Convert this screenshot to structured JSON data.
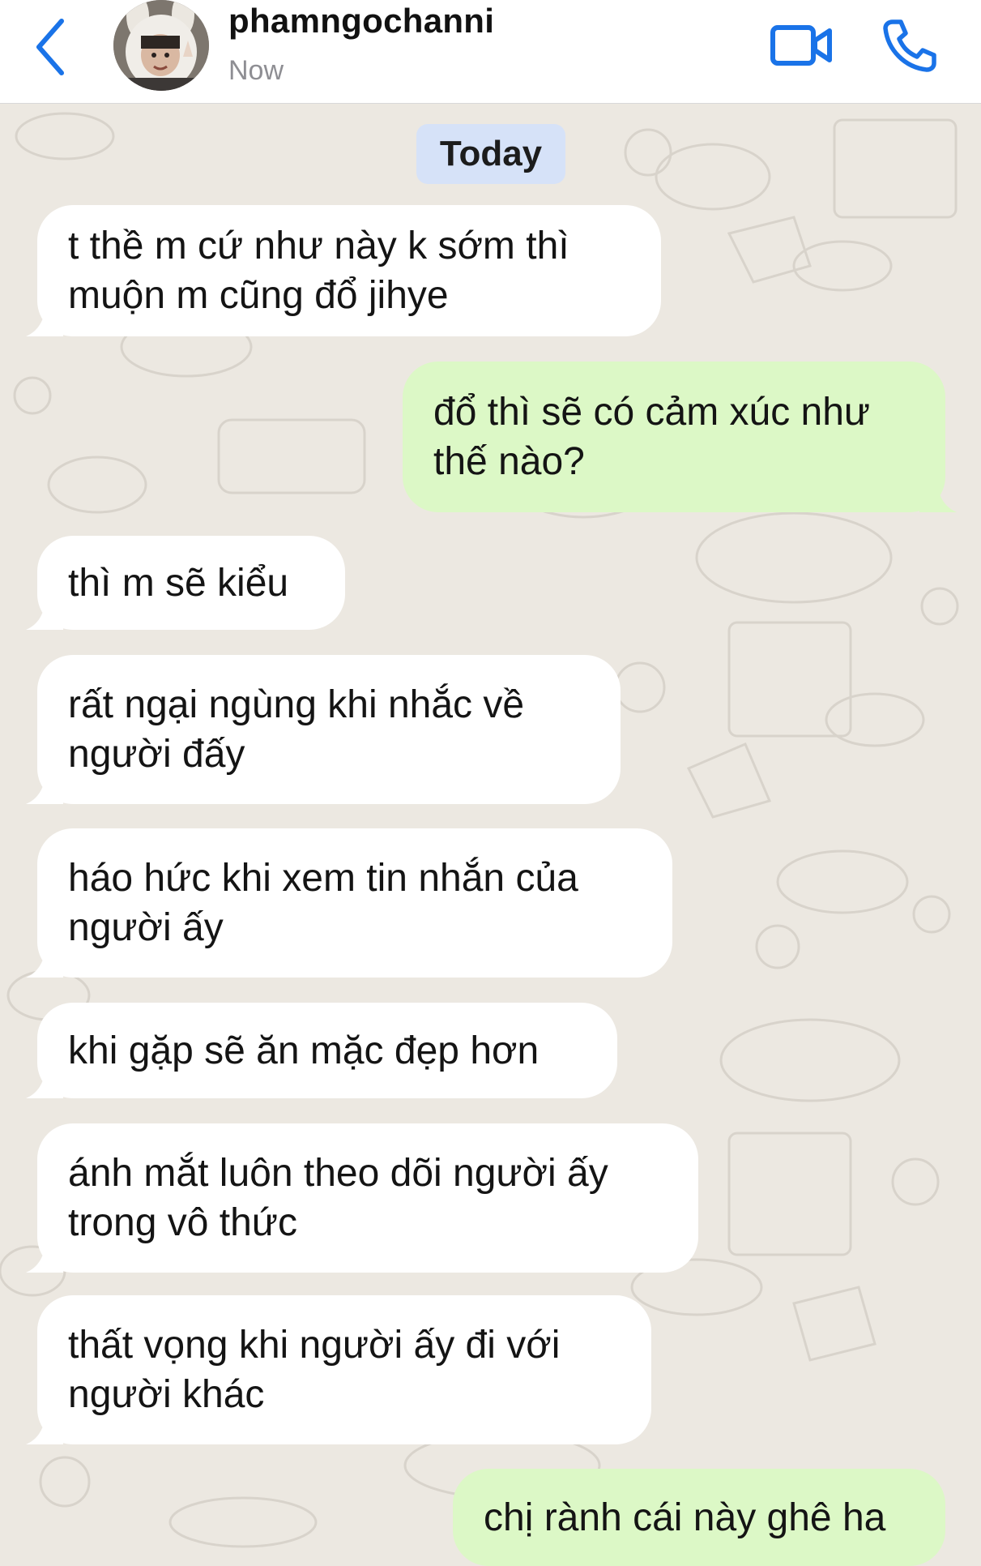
{
  "header": {
    "contact_name": "phamngochanni",
    "status": "Now"
  },
  "chat": {
    "date_label": "Today",
    "messages": [
      {
        "direction": "incoming",
        "text": "t thề m cứ như này k sớm thì muộn m cũng đổ jihye"
      },
      {
        "direction": "outgoing",
        "text": "đổ thì sẽ có cảm xúc như thế nào?"
      },
      {
        "direction": "incoming",
        "text": "thì m sẽ kiểu"
      },
      {
        "direction": "incoming",
        "text": "rất ngại ngùng khi nhắc về người đấy"
      },
      {
        "direction": "incoming",
        "text": "háo hức khi xem tin nhắn của người ấy"
      },
      {
        "direction": "incoming",
        "text": "khi gặp sẽ ăn mặc đẹp hơn"
      },
      {
        "direction": "incoming",
        "text": "ánh mắt luôn theo dõi người ấy trong vô thức"
      },
      {
        "direction": "incoming",
        "text": "thất vọng khi người ấy đi với người khác"
      },
      {
        "direction": "outgoing",
        "text": "chị rành cái này ghê ha"
      }
    ]
  },
  "colors": {
    "accent": "#1a73e8",
    "incoming_bubble": "#ffffff",
    "outgoing_bubble": "#dcf8c6",
    "date_chip": "#d6e2f8",
    "chat_background": "#ece8e1"
  },
  "icons": {
    "back": "chevron-left-icon",
    "video": "video-camera-icon",
    "call": "phone-icon"
  }
}
